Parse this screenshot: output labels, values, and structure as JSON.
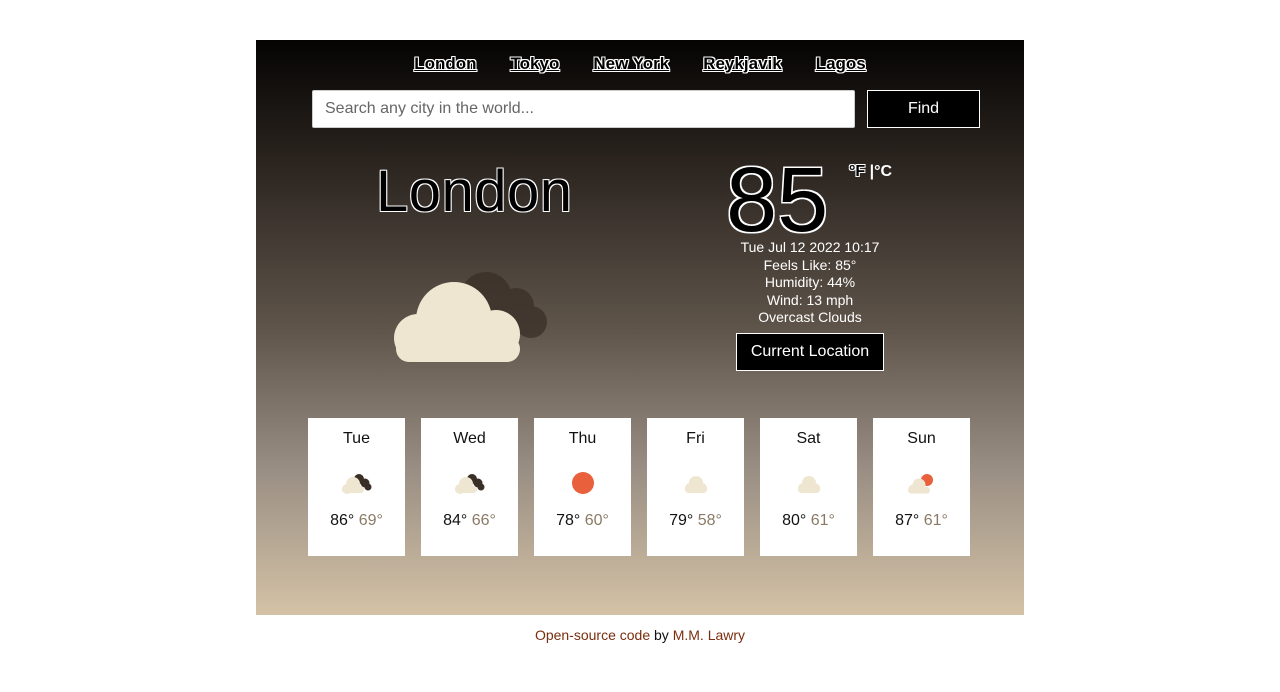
{
  "nav": {
    "cities": [
      "London",
      "Tokyo",
      "New York",
      "Reykjavik",
      "Lagos"
    ]
  },
  "search": {
    "placeholder": "Search any city in the world...",
    "button": "Find"
  },
  "current": {
    "city": "London",
    "temperature": "85",
    "unit_f": "°F",
    "unit_sep": " |",
    "unit_c": "°C",
    "datetime": "Tue Jul 12 2022 10:17",
    "feels_like": "Feels Like: 85°",
    "humidity": "Humidity: 44%",
    "wind": "Wind: 13 mph",
    "description": "Overcast Clouds",
    "icon": "overcast-clouds-icon",
    "location_button": "Current Location"
  },
  "forecast": [
    {
      "day": "Tue",
      "hi": "86°",
      "lo": "69°",
      "icon": "broken-clouds-icon"
    },
    {
      "day": "Wed",
      "hi": "84°",
      "lo": "66°",
      "icon": "broken-clouds-icon"
    },
    {
      "day": "Thu",
      "hi": "78°",
      "lo": "60°",
      "icon": "clear-sun-icon"
    },
    {
      "day": "Fri",
      "hi": "79°",
      "lo": "58°",
      "icon": "cloud-icon"
    },
    {
      "day": "Sat",
      "hi": "80°",
      "lo": "61°",
      "icon": "cloud-icon"
    },
    {
      "day": "Sun",
      "hi": "87°",
      "lo": "61°",
      "icon": "partly-sunny-icon"
    }
  ],
  "footer": {
    "code_link": "Open-source code",
    "by": " by ",
    "author_link": "M.M. Lawry"
  },
  "colors": {
    "cloud": "#efe6d2",
    "dark_cloud": "#3a2f27",
    "sun": "#e8603c",
    "link": "#7a2e0e"
  }
}
